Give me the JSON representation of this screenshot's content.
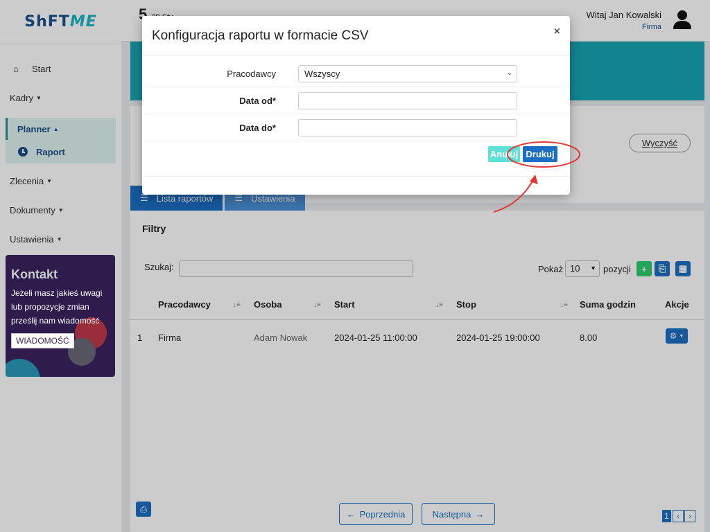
{
  "logo": {
    "part1": "ShFT",
    "part2": "ME"
  },
  "sidebar": {
    "start": "Start",
    "kadry": "Kadry",
    "planner": "Planner",
    "raport": "Raport",
    "zlecenia": "Zlecenia",
    "dokumenty": "Dokumenty",
    "ustawienia": "Ustawienia"
  },
  "contact": {
    "title": "Kontakt",
    "text": "Jeżeli masz jakieś uwagi lub propozycje zmian prześlij nam wiadomość",
    "button": "WIADOMOŚĆ"
  },
  "topbar": {
    "week_num": "5",
    "date": "29 Sty",
    "week_prefix": "ty",
    "greeting": "Witaj Jan Kowalski",
    "company": "Firma"
  },
  "filters": {
    "clear": "Wyczyść",
    "title": "Filtry"
  },
  "tabs": {
    "list": "Lista raportów",
    "settings": "Ustawienia"
  },
  "table": {
    "search_label": "Szukaj:",
    "show_label": "Pokaż",
    "show_value": "10",
    "positions_label": "pozycji",
    "headers": [
      "Pracodawcy",
      "Osoba",
      "Start",
      "Stop",
      "Suma godzin",
      "Akcje"
    ],
    "rows": [
      {
        "num": "1",
        "employer": "Firma",
        "person": "Adam Nowak",
        "start": "2024-01-25 11:00:00",
        "stop": "2024-01-25 19:00:00",
        "hours": "8.00"
      }
    ]
  },
  "pagination": {
    "prev": "Poprzednia",
    "next": "Następna",
    "page": "1"
  },
  "modal": {
    "title": "Konfiguracja raportu w formacie CSV",
    "close": "×",
    "employers_label": "Pracodawcy",
    "employers_value": "Wszyscy",
    "date_from_label": "Data od*",
    "date_to_label": "Data do*",
    "cancel": "Anuluj",
    "print": "Drukuj"
  },
  "colors": {
    "primary": "#1b6ec2",
    "teal": "#17a6b3",
    "cancel": "#5fe0d9",
    "annotation": "#e53935"
  }
}
